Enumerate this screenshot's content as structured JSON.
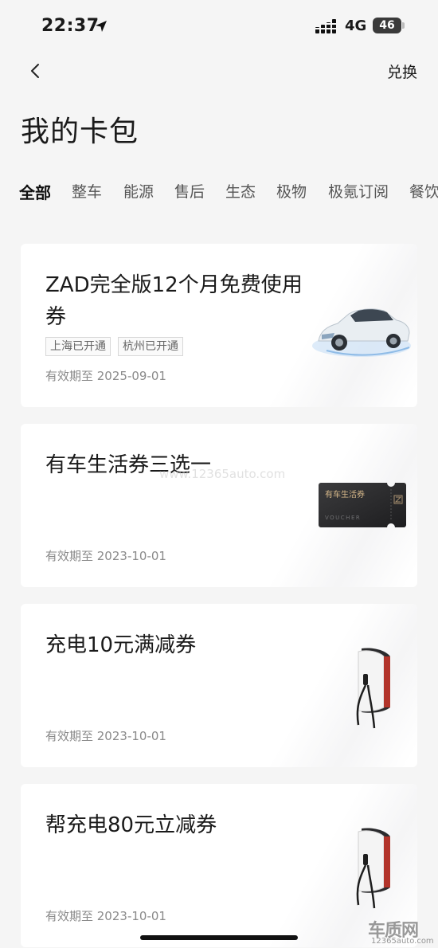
{
  "status_bar": {
    "time": "22:37",
    "network": "4G",
    "battery": "46"
  },
  "nav": {
    "action_label": "兑换"
  },
  "page_title": "我的卡包",
  "tabs": [
    {
      "label": "全部",
      "active": true
    },
    {
      "label": "整车",
      "active": false
    },
    {
      "label": "能源",
      "active": false
    },
    {
      "label": "售后",
      "active": false
    },
    {
      "label": "生态",
      "active": false
    },
    {
      "label": "极物",
      "active": false
    },
    {
      "label": "极氪订阅",
      "active": false
    },
    {
      "label": "餐饮",
      "active": false
    }
  ],
  "cards": [
    {
      "title": "ZAD完全版12个月免费使用券",
      "tags": [
        "上海已开通",
        "杭州已开通"
      ],
      "expiry": "有效期至  2025-09-01",
      "image": "car-icon"
    },
    {
      "title": "有车生活券三选一",
      "tags": [],
      "expiry": "有效期至  2023-10-01",
      "image": "voucher-card-icon",
      "voucher_label": "有车生活券",
      "voucher_sub": "VOUCHER"
    },
    {
      "title": "充电10元满减券",
      "tags": [],
      "expiry": "有效期至  2023-10-01",
      "image": "ev-charger-icon"
    },
    {
      "title": "帮充电80元立减券",
      "tags": [],
      "expiry": "有效期至  2023-10-01",
      "image": "ev-charger-icon"
    }
  ],
  "watermark": {
    "center": "www.12365auto.com",
    "logo": "车质网",
    "url": "12365auto.com"
  },
  "colors": {
    "background": "#f5f5f5",
    "card": "#ffffff",
    "text_primary": "#1a1a1a",
    "text_secondary": "#8a8a8a",
    "charger_accent": "#b2342a"
  }
}
